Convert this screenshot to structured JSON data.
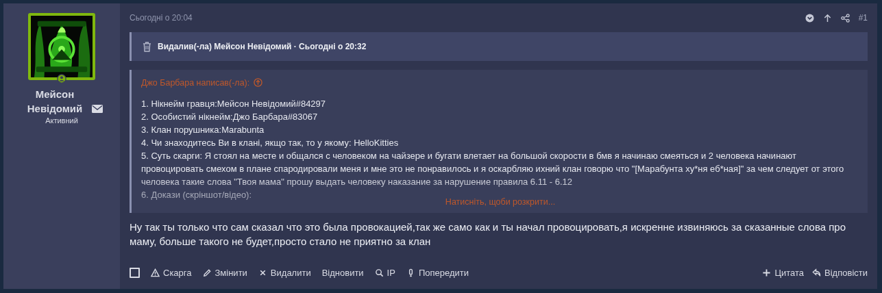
{
  "author": {
    "name": "Мейсон Невідомий",
    "status": "Активний"
  },
  "post": {
    "time": "Сьогодні о 20:04",
    "number": "#1",
    "checked": false,
    "deleted_notice": "Видалив(-ла) Мейсон Невідомий · Сьогодні о 20:32",
    "quote": {
      "author_line": "Джо Барбара написав(-ла):",
      "lines": [
        "1. Нікнейм гравця:Мейсон Невідомий#84297",
        "2. Особистий нікнейм:Джо Барбара#83067",
        "3. Клан порушника:Marabunta",
        "4. Чи знаходитесь Ви в клані, якщо так, то у якому: HelloKitties",
        "5. Суть скарги: Я стоял на месте и общался с человеком на чайзере и бугати влетает на большой скорости в бмв я начинаю смеяться и 2 человека начинают провоцировать смехом в плане спародировали меня и мне это не понравилось и я оскарбляю ихний клан говорю что \"[Марабунта ху*ня еб*ная]\" за чем следует от этого человека такие слова \"Твоя мама\" прошу выдать человеку наказание за нарушение правила 6.11 - 6.12",
        "6. Докази (скріншот/відео):"
      ],
      "expand_link": "Натисніть, щоби розкрити..."
    },
    "message": "Ну так ты только что сам сказал что это была провокацией,так же само как и ты начал провоцировать,я искренне извиняюсь за сказанные слова про маму, больше такого не будет,просто стало не приятно за клан",
    "actions": [
      {
        "kind": "report",
        "label": "Скарга"
      },
      {
        "kind": "edit",
        "label": "Змінити"
      },
      {
        "kind": "delete",
        "label": "Видалити"
      },
      {
        "kind": "restore",
        "label": "Відновити"
      },
      {
        "kind": "ip",
        "label": "IP"
      },
      {
        "kind": "warn",
        "label": "Попередити"
      }
    ],
    "reply_actions": [
      {
        "kind": "quote",
        "label": "Цитата"
      },
      {
        "kind": "reply",
        "label": "Відповісти"
      }
    ]
  }
}
